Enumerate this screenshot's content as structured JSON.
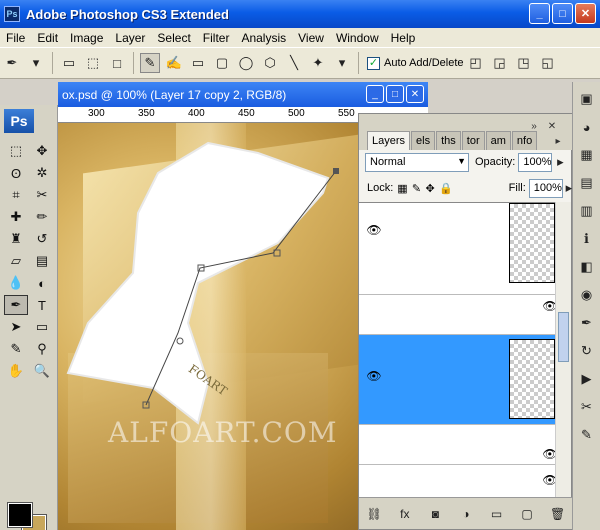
{
  "app": {
    "title": "Adobe Photoshop CS3 Extended",
    "icon_text": "Ps",
    "window_buttons": [
      "minimize",
      "maximize",
      "close"
    ]
  },
  "menu": [
    "File",
    "Edit",
    "Image",
    "Layer",
    "Select",
    "Filter",
    "Analysis",
    "View",
    "Window",
    "Help"
  ],
  "options_bar": {
    "auto_add_delete_label": "Auto Add/Delete",
    "auto_add_delete_checked": true
  },
  "toolbox": {
    "logo": "Ps",
    "foreground_color": "#000000",
    "background_color": "#c8a75b"
  },
  "document": {
    "title": "ox.psd @ 100% (Layer 17 copy 2, RGB/8)",
    "ruler_ticks": [
      "300",
      "350",
      "400",
      "450",
      "500",
      "550"
    ],
    "tag_text": "FOART",
    "watermark": "ALFOART.COM"
  },
  "layers_panel": {
    "tabs": [
      "Layers",
      "els",
      "ths",
      "tor",
      "am",
      "nfo"
    ],
    "blend_mode": "Normal",
    "opacity_label": "Opacity:",
    "opacity_value": "100%",
    "lock_label": "Lock:",
    "fill_label": "Fill:",
    "fill_value": "100%",
    "selected_color": "#3399ff"
  },
  "colors": {
    "xp_title_blue": "#0a5ce6",
    "panel_gray": "#d6d3c5"
  }
}
